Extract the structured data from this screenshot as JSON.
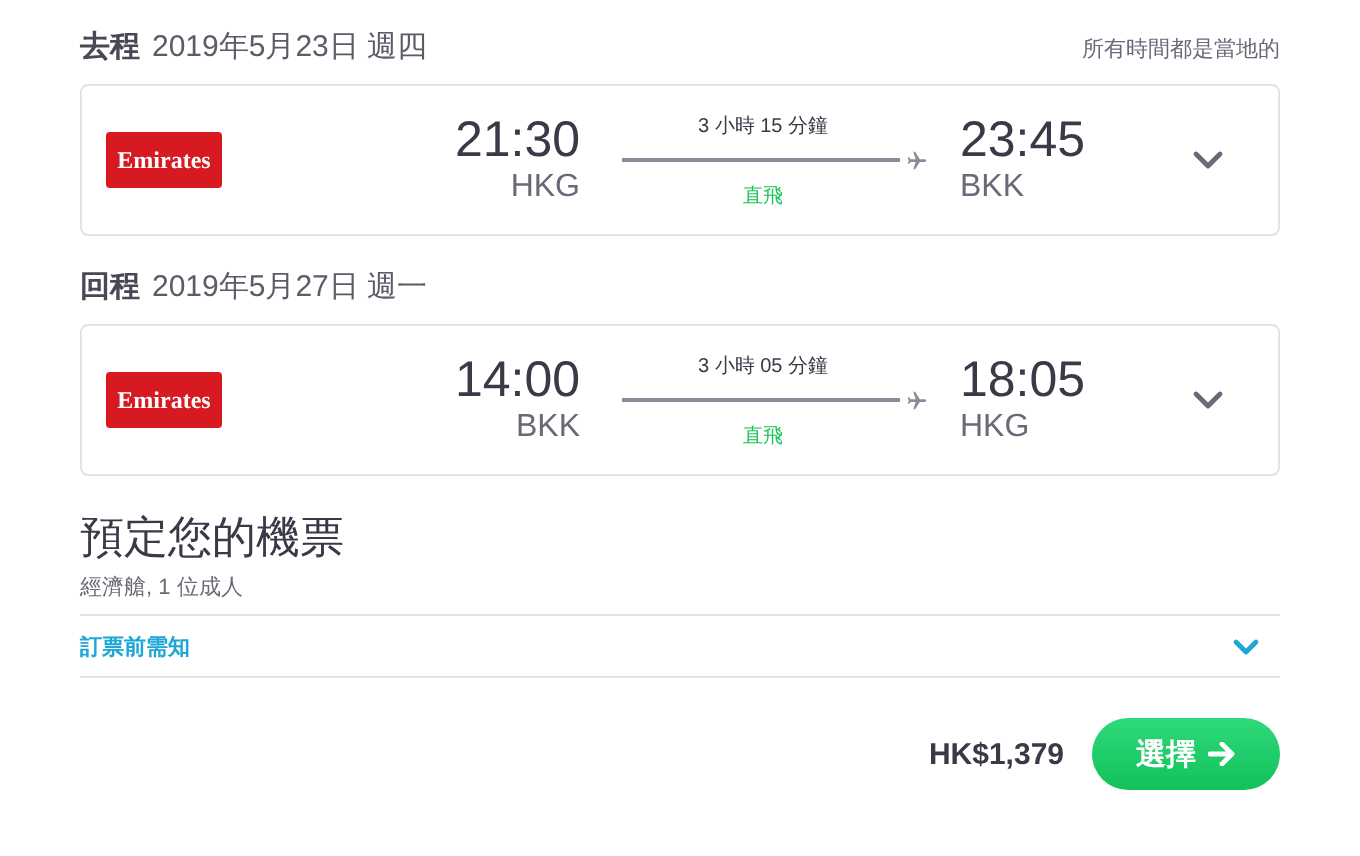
{
  "note": "所有時間都是當地的",
  "legs": [
    {
      "direction": "去程",
      "date": "2019年5月23日 週四",
      "airline": "Emirates",
      "depart_time": "21:30",
      "depart_airport": "HKG",
      "duration": "3 小時 15 分鐘",
      "stops": "直飛",
      "arrive_time": "23:45",
      "arrive_airport": "BKK",
      "expanded": false
    },
    {
      "direction": "回程",
      "date": "2019年5月27日 週一",
      "airline": "Emirates",
      "depart_time": "14:00",
      "depart_airport": "BKK",
      "duration": "3 小時 05 分鐘",
      "stops": "直飛",
      "arrive_time": "18:05",
      "arrive_airport": "HKG",
      "expanded": false
    }
  ],
  "booking": {
    "title": "預定您的機票",
    "subtitle": "經濟艙, 1 位成人",
    "notice": "訂票前需知",
    "notice_expanded": false,
    "price": "HK$1,379",
    "button": "選擇"
  }
}
